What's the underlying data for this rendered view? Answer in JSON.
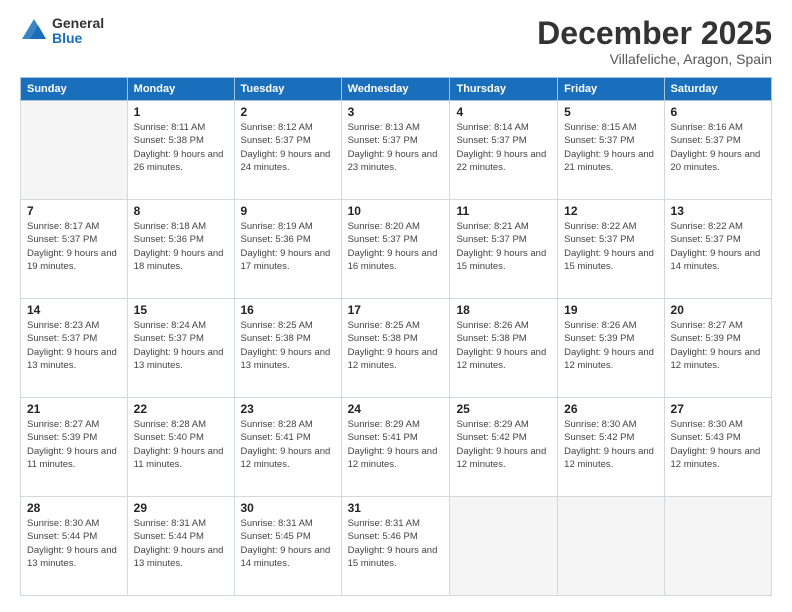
{
  "logo": {
    "general": "General",
    "blue": "Blue"
  },
  "title": "December 2025",
  "subtitle": "Villafeliche, Aragon, Spain",
  "days_of_week": [
    "Sunday",
    "Monday",
    "Tuesday",
    "Wednesday",
    "Thursday",
    "Friday",
    "Saturday"
  ],
  "weeks": [
    [
      {
        "day": "",
        "sunrise": "",
        "sunset": "",
        "daylight": "",
        "empty": true
      },
      {
        "day": "1",
        "sunrise": "Sunrise: 8:11 AM",
        "sunset": "Sunset: 5:38 PM",
        "daylight": "Daylight: 9 hours and 26 minutes."
      },
      {
        "day": "2",
        "sunrise": "Sunrise: 8:12 AM",
        "sunset": "Sunset: 5:37 PM",
        "daylight": "Daylight: 9 hours and 24 minutes."
      },
      {
        "day": "3",
        "sunrise": "Sunrise: 8:13 AM",
        "sunset": "Sunset: 5:37 PM",
        "daylight": "Daylight: 9 hours and 23 minutes."
      },
      {
        "day": "4",
        "sunrise": "Sunrise: 8:14 AM",
        "sunset": "Sunset: 5:37 PM",
        "daylight": "Daylight: 9 hours and 22 minutes."
      },
      {
        "day": "5",
        "sunrise": "Sunrise: 8:15 AM",
        "sunset": "Sunset: 5:37 PM",
        "daylight": "Daylight: 9 hours and 21 minutes."
      },
      {
        "day": "6",
        "sunrise": "Sunrise: 8:16 AM",
        "sunset": "Sunset: 5:37 PM",
        "daylight": "Daylight: 9 hours and 20 minutes."
      }
    ],
    [
      {
        "day": "7",
        "sunrise": "Sunrise: 8:17 AM",
        "sunset": "Sunset: 5:37 PM",
        "daylight": "Daylight: 9 hours and 19 minutes."
      },
      {
        "day": "8",
        "sunrise": "Sunrise: 8:18 AM",
        "sunset": "Sunset: 5:36 PM",
        "daylight": "Daylight: 9 hours and 18 minutes."
      },
      {
        "day": "9",
        "sunrise": "Sunrise: 8:19 AM",
        "sunset": "Sunset: 5:36 PM",
        "daylight": "Daylight: 9 hours and 17 minutes."
      },
      {
        "day": "10",
        "sunrise": "Sunrise: 8:20 AM",
        "sunset": "Sunset: 5:37 PM",
        "daylight": "Daylight: 9 hours and 16 minutes."
      },
      {
        "day": "11",
        "sunrise": "Sunrise: 8:21 AM",
        "sunset": "Sunset: 5:37 PM",
        "daylight": "Daylight: 9 hours and 15 minutes."
      },
      {
        "day": "12",
        "sunrise": "Sunrise: 8:22 AM",
        "sunset": "Sunset: 5:37 PM",
        "daylight": "Daylight: 9 hours and 15 minutes."
      },
      {
        "day": "13",
        "sunrise": "Sunrise: 8:22 AM",
        "sunset": "Sunset: 5:37 PM",
        "daylight": "Daylight: 9 hours and 14 minutes."
      }
    ],
    [
      {
        "day": "14",
        "sunrise": "Sunrise: 8:23 AM",
        "sunset": "Sunset: 5:37 PM",
        "daylight": "Daylight: 9 hours and 13 minutes."
      },
      {
        "day": "15",
        "sunrise": "Sunrise: 8:24 AM",
        "sunset": "Sunset: 5:37 PM",
        "daylight": "Daylight: 9 hours and 13 minutes."
      },
      {
        "day": "16",
        "sunrise": "Sunrise: 8:25 AM",
        "sunset": "Sunset: 5:38 PM",
        "daylight": "Daylight: 9 hours and 13 minutes."
      },
      {
        "day": "17",
        "sunrise": "Sunrise: 8:25 AM",
        "sunset": "Sunset: 5:38 PM",
        "daylight": "Daylight: 9 hours and 12 minutes."
      },
      {
        "day": "18",
        "sunrise": "Sunrise: 8:26 AM",
        "sunset": "Sunset: 5:38 PM",
        "daylight": "Daylight: 9 hours and 12 minutes."
      },
      {
        "day": "19",
        "sunrise": "Sunrise: 8:26 AM",
        "sunset": "Sunset: 5:39 PM",
        "daylight": "Daylight: 9 hours and 12 minutes."
      },
      {
        "day": "20",
        "sunrise": "Sunrise: 8:27 AM",
        "sunset": "Sunset: 5:39 PM",
        "daylight": "Daylight: 9 hours and 12 minutes."
      }
    ],
    [
      {
        "day": "21",
        "sunrise": "Sunrise: 8:27 AM",
        "sunset": "Sunset: 5:39 PM",
        "daylight": "Daylight: 9 hours and 11 minutes."
      },
      {
        "day": "22",
        "sunrise": "Sunrise: 8:28 AM",
        "sunset": "Sunset: 5:40 PM",
        "daylight": "Daylight: 9 hours and 11 minutes."
      },
      {
        "day": "23",
        "sunrise": "Sunrise: 8:28 AM",
        "sunset": "Sunset: 5:41 PM",
        "daylight": "Daylight: 9 hours and 12 minutes."
      },
      {
        "day": "24",
        "sunrise": "Sunrise: 8:29 AM",
        "sunset": "Sunset: 5:41 PM",
        "daylight": "Daylight: 9 hours and 12 minutes."
      },
      {
        "day": "25",
        "sunrise": "Sunrise: 8:29 AM",
        "sunset": "Sunset: 5:42 PM",
        "daylight": "Daylight: 9 hours and 12 minutes."
      },
      {
        "day": "26",
        "sunrise": "Sunrise: 8:30 AM",
        "sunset": "Sunset: 5:42 PM",
        "daylight": "Daylight: 9 hours and 12 minutes."
      },
      {
        "day": "27",
        "sunrise": "Sunrise: 8:30 AM",
        "sunset": "Sunset: 5:43 PM",
        "daylight": "Daylight: 9 hours and 12 minutes."
      }
    ],
    [
      {
        "day": "28",
        "sunrise": "Sunrise: 8:30 AM",
        "sunset": "Sunset: 5:44 PM",
        "daylight": "Daylight: 9 hours and 13 minutes."
      },
      {
        "day": "29",
        "sunrise": "Sunrise: 8:31 AM",
        "sunset": "Sunset: 5:44 PM",
        "daylight": "Daylight: 9 hours and 13 minutes."
      },
      {
        "day": "30",
        "sunrise": "Sunrise: 8:31 AM",
        "sunset": "Sunset: 5:45 PM",
        "daylight": "Daylight: 9 hours and 14 minutes."
      },
      {
        "day": "31",
        "sunrise": "Sunrise: 8:31 AM",
        "sunset": "Sunset: 5:46 PM",
        "daylight": "Daylight: 9 hours and 15 minutes."
      },
      {
        "day": "",
        "sunrise": "",
        "sunset": "",
        "daylight": "",
        "empty": true
      },
      {
        "day": "",
        "sunrise": "",
        "sunset": "",
        "daylight": "",
        "empty": true
      },
      {
        "day": "",
        "sunrise": "",
        "sunset": "",
        "daylight": "",
        "empty": true
      }
    ]
  ]
}
